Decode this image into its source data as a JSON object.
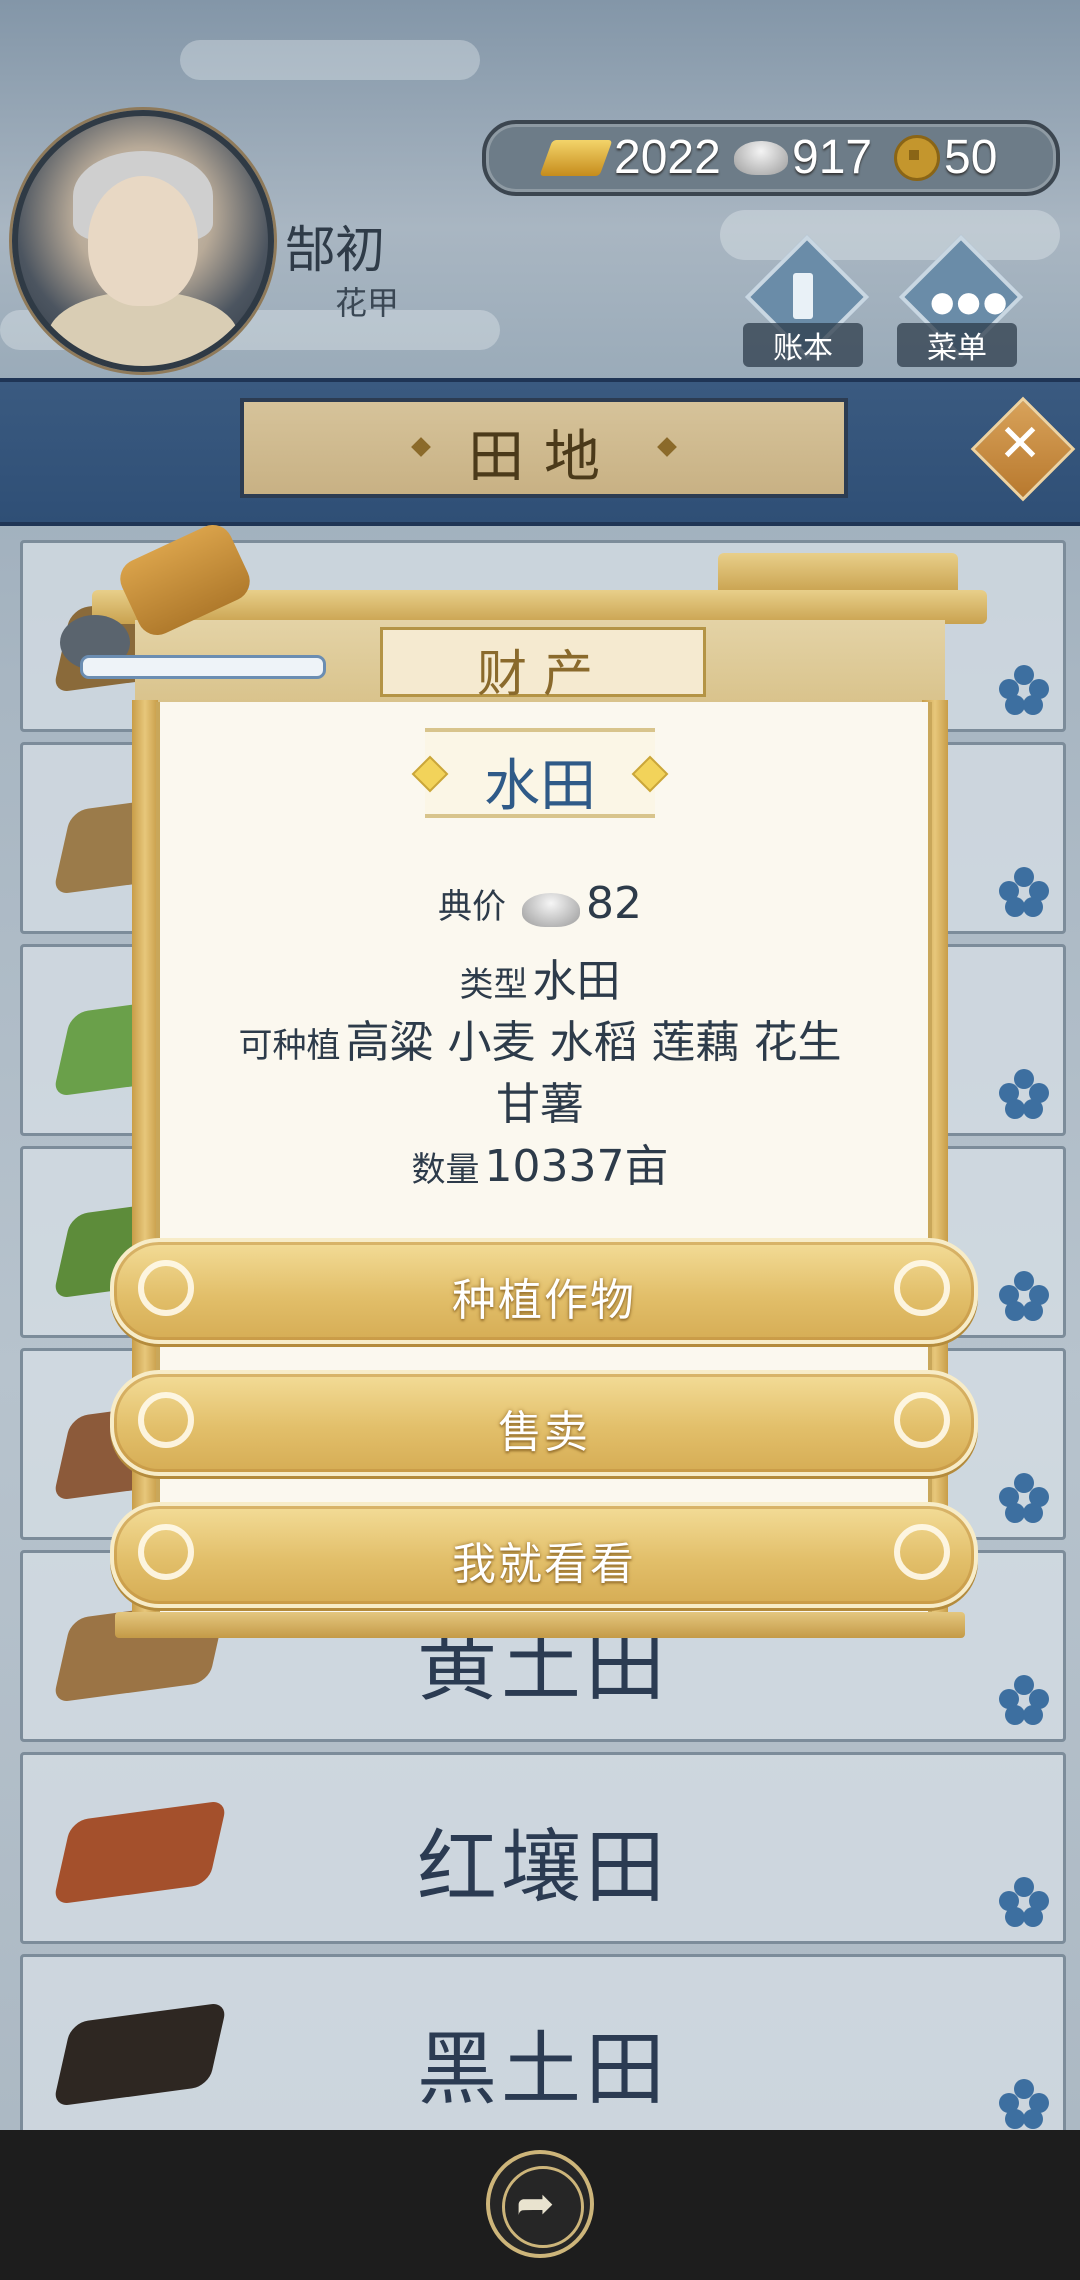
{
  "player": {
    "name": "郜初",
    "title": "花甲"
  },
  "currency": {
    "gold": "2022",
    "silver": "917",
    "coins": "50"
  },
  "top_menu": {
    "ledger": "账本",
    "menu": "菜单"
  },
  "page": {
    "title": "田地",
    "close": "✕"
  },
  "fields": [
    {
      "label": "",
      "plot_color": "#8a6a3a"
    },
    {
      "label": "",
      "plot_color": "#9b7b4a"
    },
    {
      "label": "",
      "plot_color": "#6aa04a"
    },
    {
      "label": "",
      "plot_color": "#5d8c3a"
    },
    {
      "label": "",
      "plot_color": "#8c5a3a"
    },
    {
      "label": "黄土田",
      "plot_color": "#9b7445"
    },
    {
      "label": "红壤田",
      "plot_color": "#a4502c"
    },
    {
      "label": "黑土田",
      "plot_color": "#2e2722"
    }
  ],
  "modal": {
    "header": "财产",
    "property_name": "水田",
    "price_label": "典价",
    "price_value": "82",
    "type_label": "类型",
    "type_value": "水田",
    "plantable_label": "可种植",
    "plantable_values_line1": "高粱 小麦 水稻 莲藕 花生",
    "plantable_values_line2": "甘薯",
    "quantity_label": "数量",
    "quantity_value": "10337亩",
    "buttons": {
      "plant": "种植作物",
      "sell": "售卖",
      "just_look": "我就看看"
    }
  },
  "colors": {
    "banner_band": "#2f4f76",
    "accent_gold": "#e2bf6a",
    "title_blue": "#2f5a88"
  },
  "icons": [
    "gold-ingot-icon",
    "silver-ingot-icon",
    "copper-coin-icon",
    "ledger-icon",
    "menu-dots-icon",
    "close-icon",
    "flower-icon",
    "share-icon"
  ]
}
